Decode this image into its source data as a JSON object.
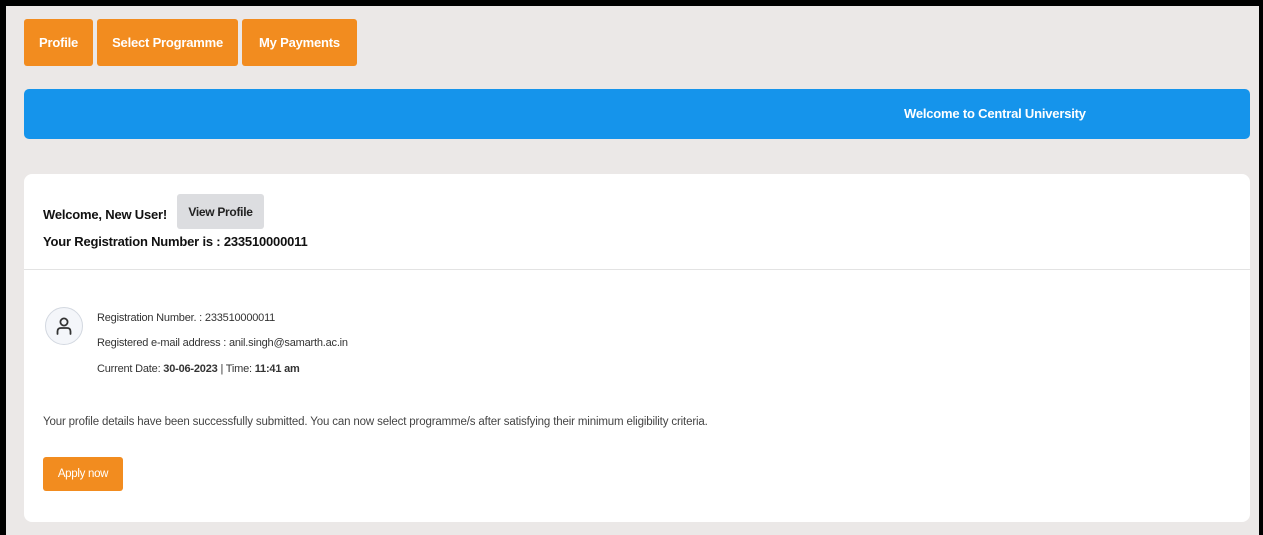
{
  "nav": {
    "profile": "Profile",
    "select_programme": "Select Programme",
    "my_payments": "My Payments"
  },
  "banner": {
    "text": "Welcome to Central University"
  },
  "card": {
    "welcome": "Welcome, New User!",
    "view_profile": "View Profile",
    "registration_line": "Your Registration Number is : 233510000011",
    "info": {
      "reg_label": "Registration Number. :",
      "reg_value": "233510000011",
      "email_label": "Registered e-mail address :",
      "email_value": "anil.singh@samarth.ac.in",
      "date_label": "Current Date:",
      "date_value": "30-06-2023",
      "sep": "|",
      "time_label": "Time:",
      "time_value": "11:41 am"
    },
    "message": "Your profile details have been successfully submitted. You can now select programme/s after satisfying their minimum eligibility criteria.",
    "apply_now": "Apply now"
  },
  "colors": {
    "accent": "#f28c1f",
    "banner": "#1594eb",
    "background": "#ebe8e7"
  },
  "icons": {
    "avatar": "user-icon"
  }
}
